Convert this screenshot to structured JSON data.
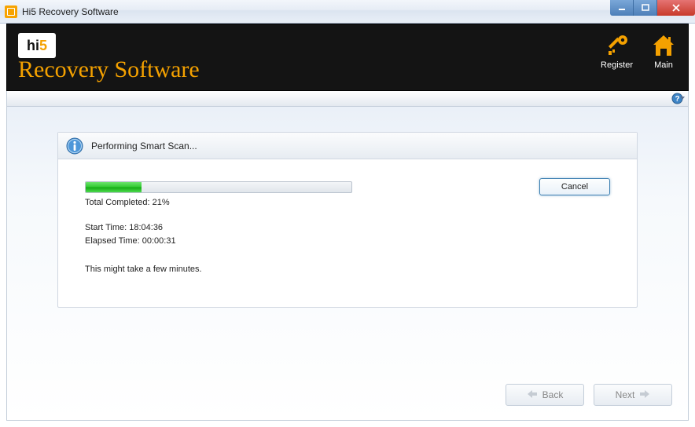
{
  "window": {
    "title": "Hi5 Recovery Software"
  },
  "header": {
    "logo_hi": "hi",
    "logo_5": "5",
    "product_name": "Recovery Software",
    "register_label": "Register",
    "main_label": "Main"
  },
  "scan": {
    "header_text": "Performing Smart Scan...",
    "progress_percent": 21,
    "total_completed_label": "Total Completed: 21%",
    "start_time_label": "Start Time: 18:04:36",
    "elapsed_time_label": "Elapsed Time: 00:00:31",
    "hint_text": "This might take a few minutes.",
    "cancel_label": "Cancel"
  },
  "footer": {
    "back_label": "Back",
    "next_label": "Next"
  }
}
